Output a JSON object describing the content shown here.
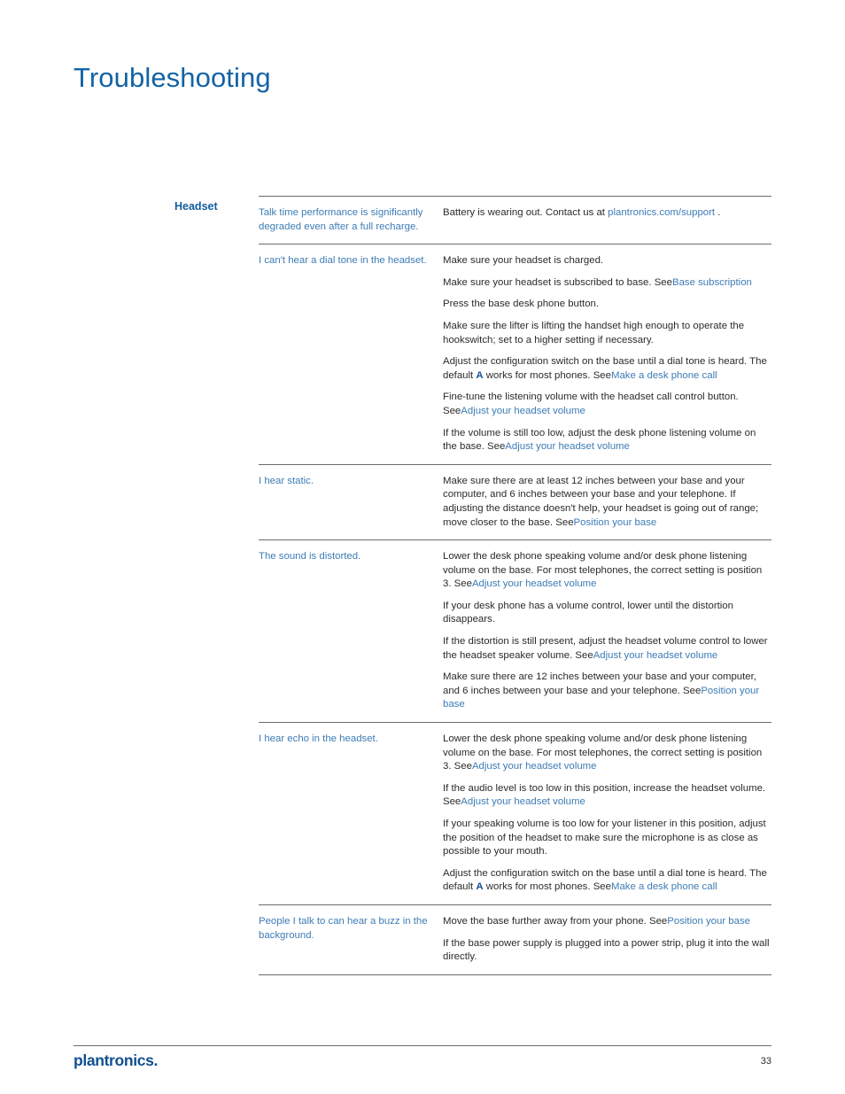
{
  "document": {
    "title": "Troubleshooting",
    "section_label": "Headset",
    "footer": {
      "logo_text": "plantronics",
      "logo_dot": ".",
      "page_number": "33"
    }
  },
  "table": {
    "rows": [
      {
        "symptom": "Talk time performance is significantly degraded even after a full recharge.",
        "solutions": [
          {
            "segments": [
              {
                "text": "Battery is wearing out. Contact us at ",
                "type": "text"
              },
              {
                "text": "plantronics.com/support",
                "type": "link"
              },
              {
                "text": " .",
                "type": "text"
              }
            ]
          }
        ]
      },
      {
        "symptom": "I can't hear a dial tone in the headset.",
        "solutions": [
          {
            "segments": [
              {
                "text": "Make sure your headset is charged.",
                "type": "text"
              }
            ]
          },
          {
            "segments": [
              {
                "text": "Make sure your headset is subscribed to base. See",
                "type": "text"
              },
              {
                "text": "Base subscription",
                "type": "link"
              }
            ]
          },
          {
            "segments": [
              {
                "text": "Press the base desk phone button.",
                "type": "text"
              }
            ]
          },
          {
            "segments": [
              {
                "text": "Make sure the lifter is lifting the handset high enough to operate the hookswitch; set to a higher setting if necessary.",
                "type": "text"
              }
            ]
          },
          {
            "segments": [
              {
                "text": "Adjust the configuration switch on the base until a dial tone is heard. The default ",
                "type": "text"
              },
              {
                "text": "A",
                "type": "bold"
              },
              {
                "text": " works for most phones. See",
                "type": "text"
              },
              {
                "text": "Make a desk phone call",
                "type": "link"
              }
            ]
          },
          {
            "segments": [
              {
                "text": "Fine-tune the listening volume with the headset call control button. See",
                "type": "text"
              },
              {
                "text": "Adjust your headset volume",
                "type": "link"
              }
            ]
          },
          {
            "segments": [
              {
                "text": "If the volume is still too low, adjust the desk phone listening volume on the base. See",
                "type": "text"
              },
              {
                "text": "Adjust your headset volume",
                "type": "link"
              }
            ]
          }
        ]
      },
      {
        "symptom": "I hear static.",
        "solutions": [
          {
            "segments": [
              {
                "text": "Make sure there are at least 12 inches between your base and your computer, and 6 inches between your base and your telephone. If adjusting the distance doesn't help, your headset is going out of range; move closer to the base. See",
                "type": "text"
              },
              {
                "text": "Position your base",
                "type": "link"
              }
            ]
          }
        ]
      },
      {
        "symptom": "The sound is distorted.",
        "solutions": [
          {
            "segments": [
              {
                "text": "Lower the desk phone speaking volume and/or desk phone listening volume on the base. For most telephones, the correct setting is position 3. See",
                "type": "text"
              },
              {
                "text": "Adjust your headset volume",
                "type": "link"
              }
            ]
          },
          {
            "segments": [
              {
                "text": "If your desk phone has a volume control, lower until the distortion disappears.",
                "type": "text"
              }
            ]
          },
          {
            "segments": [
              {
                "text": "If the distortion is still present, adjust the headset volume control to lower the headset speaker volume. See",
                "type": "text"
              },
              {
                "text": "Adjust your headset volume",
                "type": "link"
              }
            ]
          },
          {
            "segments": [
              {
                "text": "Make sure there are 12 inches between your base and your computer, and 6 inches between your base and your telephone. See",
                "type": "text"
              },
              {
                "text": "Position your base",
                "type": "link"
              }
            ]
          }
        ]
      },
      {
        "symptom": "I hear echo in the headset.",
        "solutions": [
          {
            "segments": [
              {
                "text": "Lower the desk phone speaking volume and/or desk phone listening volume on the base. For most telephones, the correct setting is position 3. See",
                "type": "text"
              },
              {
                "text": "Adjust your headset volume",
                "type": "link"
              }
            ]
          },
          {
            "segments": [
              {
                "text": "If the audio level is too low in this position, increase the headset volume. See",
                "type": "text"
              },
              {
                "text": "Adjust your headset volume",
                "type": "link"
              }
            ]
          },
          {
            "segments": [
              {
                "text": "If your speaking volume is too low for your listener in this position, adjust the position of the headset to make sure the microphone is as close as possible to your mouth.",
                "type": "text"
              }
            ]
          },
          {
            "segments": [
              {
                "text": "Adjust the configuration switch on the base until a dial tone is heard. The default ",
                "type": "text"
              },
              {
                "text": "A",
                "type": "bold"
              },
              {
                "text": " works for most phones. See",
                "type": "text"
              },
              {
                "text": "Make a desk phone call",
                "type": "link"
              }
            ]
          }
        ]
      },
      {
        "symptom": "People I talk to can hear a buzz in the background.",
        "solutions": [
          {
            "segments": [
              {
                "text": "Move the base further away from your phone. See",
                "type": "text"
              },
              {
                "text": "Position your base",
                "type": "link"
              }
            ]
          },
          {
            "segments": [
              {
                "text": "If the base power supply is plugged into a power strip, plug it into the wall directly.",
                "type": "text"
              }
            ]
          }
        ]
      }
    ]
  },
  "colors": {
    "title_blue": "#1263a5",
    "link_blue": "#3d7cb5",
    "label_blue": "#135d9e",
    "body_text": "#2b2b2b",
    "rule": "#6b6b6b"
  }
}
